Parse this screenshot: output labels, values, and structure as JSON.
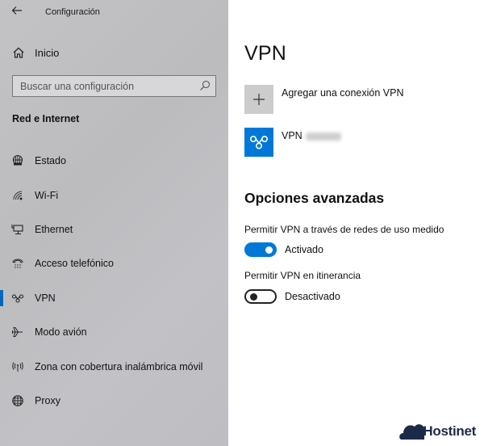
{
  "window": {
    "title": "Configuración",
    "back_icon": "arrow-left-icon"
  },
  "sidebar": {
    "home": {
      "label": "Inicio",
      "icon": "home-icon"
    },
    "search": {
      "placeholder": "Buscar una configuración",
      "value": "",
      "icon": "search-icon"
    },
    "section_title": "Red e Internet",
    "items": [
      {
        "label": "Estado",
        "icon": "globe-status-icon",
        "selected": false
      },
      {
        "label": "Wi-Fi",
        "icon": "wifi-icon",
        "selected": false
      },
      {
        "label": "Ethernet",
        "icon": "ethernet-icon",
        "selected": false
      },
      {
        "label": "Acceso telefónico",
        "icon": "dial-up-phone-icon",
        "selected": false
      },
      {
        "label": "VPN",
        "icon": "vpn-icon",
        "selected": true
      },
      {
        "label": "Modo avión",
        "icon": "airplane-icon",
        "selected": false
      },
      {
        "label": "Zona con cobertura inalámbrica móvil",
        "icon": "mobile-hotspot-icon",
        "selected": false
      },
      {
        "label": "Proxy",
        "icon": "globe-icon",
        "selected": false
      }
    ]
  },
  "main": {
    "title": "VPN",
    "add_connection": {
      "label": "Agregar una conexión VPN",
      "icon": "plus-icon"
    },
    "connections": [
      {
        "label": "VPN",
        "name_obscured": true,
        "icon": "vpn-icon"
      }
    ],
    "advanced": {
      "title": "Opciones avanzadas",
      "options": [
        {
          "label": "Permitir VPN a través de redes de uso medido",
          "state": true,
          "state_label": "Activado"
        },
        {
          "label": "Permitir VPN en itinerancia",
          "state": false,
          "state_label": "Desactivado"
        }
      ]
    }
  },
  "watermark": {
    "text": "Hostinet",
    "icon": "cloud-icon"
  },
  "colors": {
    "accent": "#0078d7",
    "selection_bar": "#0067c0",
    "sidebar_bg": "#c0c0c3",
    "add_tile": "#cccccc"
  }
}
